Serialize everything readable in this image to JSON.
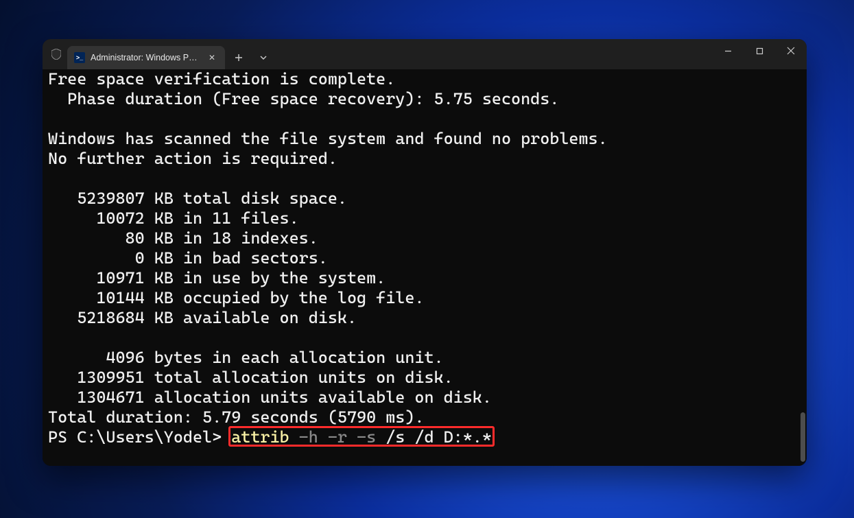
{
  "window": {
    "tab_title": "Administrator: Windows Powe…",
    "new_tab_tooltip": "+",
    "dropdown_tooltip": "⌄",
    "min_tooltip": "Minimize",
    "max_tooltip": "Maximize",
    "close_tooltip": "Close"
  },
  "terminal": {
    "lines": [
      "Free space verification is complete.",
      "  Phase duration (Free space recovery): 5.75 seconds.",
      "",
      "Windows has scanned the file system and found no problems.",
      "No further action is required.",
      "",
      "   5239807 KB total disk space.",
      "     10072 KB in 11 files.",
      "        80 KB in 18 indexes.",
      "         0 KB in bad sectors.",
      "     10971 KB in use by the system.",
      "     10144 KB occupied by the log file.",
      "   5218684 KB available on disk.",
      "",
      "      4096 bytes in each allocation unit.",
      "   1309951 total allocation units on disk.",
      "   1304671 allocation units available on disk.",
      "Total duration: 5.79 seconds (5790 ms)."
    ],
    "prompt_prefix": "PS C:\\Users\\Yodel> ",
    "command": {
      "cmd": "attrib",
      "flags": " -h -r -s",
      "rest": " /s /d D:*.*"
    }
  },
  "annotation": {
    "highlight_box_purpose": "red rectangle around the typed attrib command"
  }
}
